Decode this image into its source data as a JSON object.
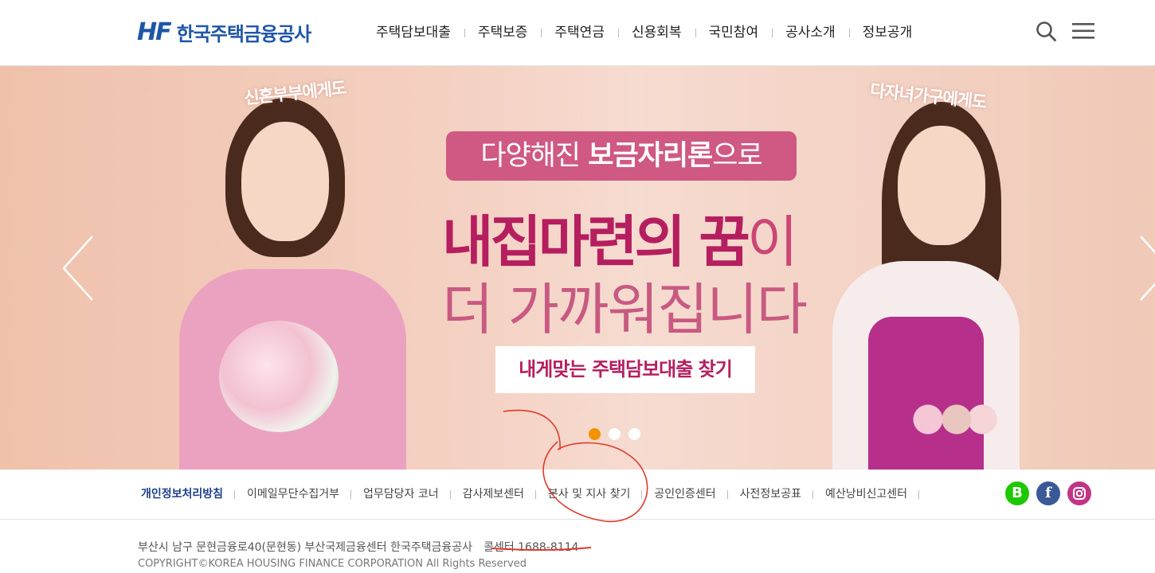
{
  "header": {
    "logo_mark": "HF",
    "logo_text": "한국주택금융공사",
    "nav": [
      "주택담보대출",
      "주택보증",
      "주택연금",
      "신용회복",
      "국민참여",
      "공사소개",
      "정보공개"
    ],
    "icons": [
      "search-icon",
      "hamburger-menu-icon"
    ]
  },
  "banner": {
    "tag_left": "신혼부부에게도",
    "tag_right": "다자녀가구에게도",
    "pill_prefix": "다양해진 ",
    "pill_strong": "보금자리론",
    "pill_suffix": "으로",
    "headline_strong": "내집마련의 꿈",
    "headline_rest": "이",
    "subline": "더 가까워집니다",
    "cta": "내게맞는 주택담보대출 찾기",
    "slides_total": 3,
    "active_slide": 1
  },
  "footer": {
    "links": [
      "개인정보처리방침",
      "이메일무단수집거부",
      "업무담당자 코너",
      "감사제보센터",
      "본사 및 지사 찾기",
      "공인인증센터",
      "사전정보공표",
      "예산낭비신고센터"
    ],
    "social": {
      "blog": "B",
      "facebook": "f",
      "instagram": ""
    },
    "address": "부산시 남구 문현금융로40(문현동) 부산국제금융센터 한국주택금융공사",
    "call_center": "콜센터 1688-8114",
    "copyright": "COPYRIGHT©KOREA HOUSING FINANCE CORPORATION All Rights Reserved"
  },
  "colors": {
    "brand_blue": "#1f56a8",
    "brand_orange": "#f29300",
    "accent_pink": "#b51e5f",
    "annotation_red": "#e03a2c"
  }
}
